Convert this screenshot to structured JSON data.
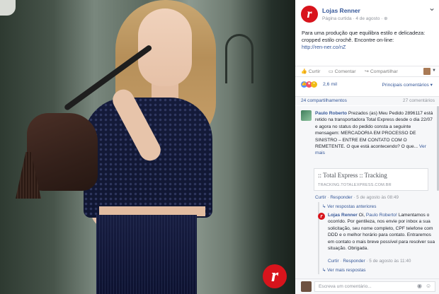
{
  "brand": {
    "accent": "#d8141c",
    "link": "#365899",
    "logo_letter": "r"
  },
  "post": {
    "page_name": "Lojas Renner",
    "meta": "Página curtida · 4 de agosto ·",
    "globe_icon": "globe-icon",
    "text": "Para uma produção que equilibra estilo e delicadeza: cropped estilo crochê. Encontre on-line:",
    "link": "http://ren-ner.co/nZ"
  },
  "actions": {
    "like": "Curtir",
    "comment": "Comentar",
    "share": "Compartilhar"
  },
  "reactions": {
    "count": "2,6 mil",
    "sort": "Principais comentários ▾"
  },
  "counts": {
    "shares": "24 compartilhamentos",
    "comments": "27 comentários"
  },
  "comments": [
    {
      "author": "Paulo Roberto",
      "text": " Prezados (as) Meu Pedido 2896117 está retido na transportadora Total Express desde o dia 22/07 e agora no status do pedido consta a seguinte mensagem: MERCADORIA EM PROCESSO DE SINISTRO – ENTRE EM CONTATO COM O REMETENTE. O que está acontecendo? O que...",
      "more": "Ver mais",
      "link_title": ":: Total Express :: Tracking",
      "link_domain": "TRACKING.TOTALEXPRESS.COM.BR",
      "reply": "Curtir",
      "respond": "Responder",
      "time": "5 de agosto às 08:49",
      "prev_replies": "Ver respostas anteriores"
    }
  ],
  "reply": {
    "author": "Lojas Renner",
    "mention": "Paulo Roberto!",
    "text_before": " Oi, ",
    "text": " Lamentamos o ocorrido. Por gentileza, nos envie por inbox a sua solicitação, seu nome completo, CPF telefone com DDD e o melhor horário para contato. Entraremos em contato o mais breve possível para resolver sua situação. Obrigada.",
    "like": "Curtir",
    "respond": "Responder",
    "time": "5 de agosto às 11:40",
    "more_replies": "Ver mais respostas"
  },
  "composer": {
    "placeholder": "Escreva um comentário..."
  }
}
